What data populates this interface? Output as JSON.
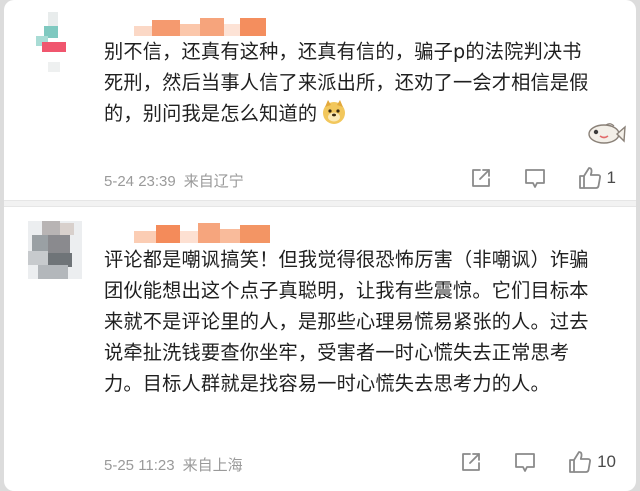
{
  "comments": [
    {
      "text": "别不信，还真有这种，还真有信的，骗子p的法院判决书死刑，然后当事人信了来派出所，还劝了一会才相信是假的，别问我是怎么知道的",
      "time": "5-24 23:39",
      "location": "来自辽宁",
      "like_count": "1",
      "emoji_icon": "doge-icon",
      "sticker_icon": "fish-icon"
    },
    {
      "text": "评论都是嘲讽搞笑！但我觉得很恐怖厉害（非嘲讽）诈骗团伙能想出这个点子真聪明，让我有些震惊。它们目标本来就不是评论里的人，是那些心理易慌易紧张的人。过去说牵扯洗钱要查你坐牢，受害者一时心慌失去正常思考力。目标人群就是找容易一时心慌失去思考力的人。",
      "time": "5-25 11:23",
      "location": "来自上海",
      "like_count": "10"
    }
  ],
  "colors": {
    "text": "#1f1f1f",
    "meta": "#9a9a9a",
    "icon": "#8a8a8a",
    "name_blur": "#f6a77f"
  }
}
